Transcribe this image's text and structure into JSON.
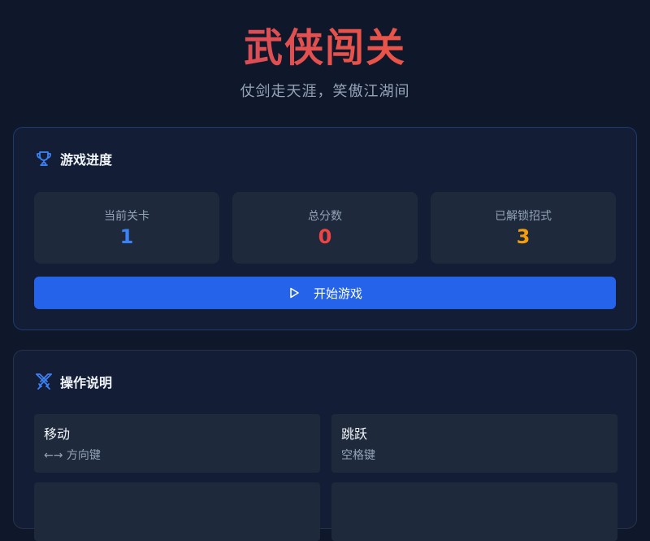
{
  "header": {
    "title": "武侠闯关",
    "subtitle": "仗剑走天涯，笑傲江湖间"
  },
  "progress": {
    "heading": "游戏进度",
    "icon": "trophy-icon",
    "stats": [
      {
        "label": "当前关卡",
        "value": "1",
        "color": "#3b82f6"
      },
      {
        "label": "总分数",
        "value": "0",
        "color": "#ef4444"
      },
      {
        "label": "已解锁招式",
        "value": "3",
        "color": "#f59e0b"
      }
    ],
    "start_button": {
      "label": "开始游戏",
      "icon": "play-icon"
    }
  },
  "controls": {
    "heading": "操作说明",
    "icon": "crossed-swords-icon",
    "items": [
      {
        "name": "移动",
        "key": "←→ 方向键"
      },
      {
        "name": "跳跃",
        "key": "空格键"
      },
      {
        "name": "",
        "key": ""
      },
      {
        "name": "",
        "key": ""
      }
    ]
  },
  "colors": {
    "background": "#0f172a",
    "card": "#131d35",
    "accent": "#2563eb",
    "title_gradient": [
      "#c0456e",
      "#f25d3a"
    ]
  }
}
